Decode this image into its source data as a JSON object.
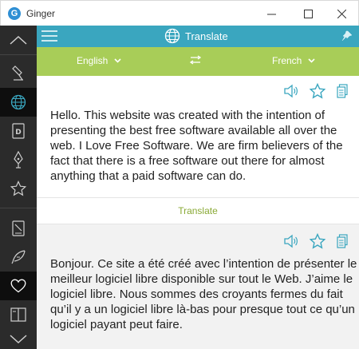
{
  "window": {
    "title": "Ginger",
    "logo_letter": "G"
  },
  "header": {
    "title": "Translate"
  },
  "languages": {
    "source": "English",
    "target": "French"
  },
  "source": {
    "text": "Hello. This website was created with the intention of presenting the best free software available all over the web. I Love Free Software. We are firm believers of the fact that there is a free software out there for almost anything that a paid software can do."
  },
  "translate_button": {
    "label": "Translate"
  },
  "target": {
    "text": "Bonjour. Ce site a été créé avec l’intention de présenter le meilleur logiciel libre disponible sur tout le Web. J’aime le logiciel libre. Nous sommes des croyants fermes du fait qu’il y a un logiciel libre là-bas pour presque tout ce qu’un logiciel payant peut faire."
  },
  "sidebar": {
    "items": [
      {
        "icon": "collapse-chevron-icon"
      },
      {
        "icon": "pen-icon"
      },
      {
        "icon": "globe-icon",
        "active": true
      },
      {
        "icon": "dictionary-icon"
      },
      {
        "icon": "fountain-pen-icon"
      },
      {
        "icon": "star-icon"
      },
      {
        "icon": "notebook-icon"
      },
      {
        "icon": "feather-icon"
      },
      {
        "icon": "heart-icon"
      },
      {
        "icon": "book-icon"
      },
      {
        "icon": "expand-chevron-icon"
      }
    ]
  },
  "colors": {
    "header_bar": "#3aa6bf",
    "language_bar": "#a8cd58",
    "sidebar": "#2b2b2b",
    "accent_icon": "#3aa6bf",
    "translate_text": "#8aaa36"
  }
}
